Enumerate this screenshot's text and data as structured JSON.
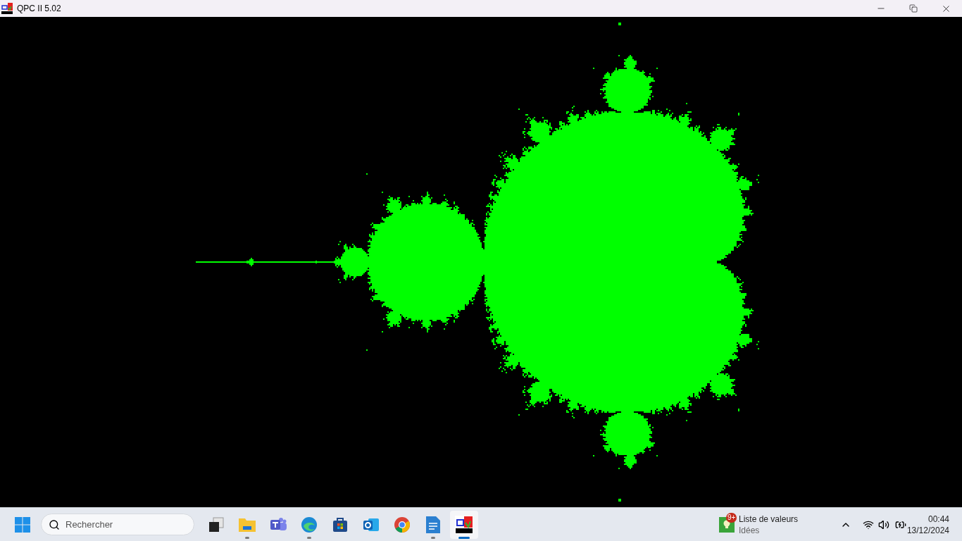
{
  "window": {
    "title": "QPC II 5.02"
  },
  "taskbar": {
    "search": {
      "placeholder": "Rechercher"
    },
    "apps": [
      {
        "kind": "taskview",
        "running": false,
        "selected": false
      },
      {
        "kind": "folder",
        "running": true,
        "selected": false
      },
      {
        "kind": "teams",
        "running": false,
        "selected": false
      },
      {
        "kind": "edge",
        "running": true,
        "selected": false
      },
      {
        "kind": "store",
        "running": false,
        "selected": false
      },
      {
        "kind": "outlook",
        "running": false,
        "selected": false
      },
      {
        "kind": "chrome",
        "running": false,
        "selected": false
      },
      {
        "kind": "writer",
        "running": true,
        "selected": false
      },
      {
        "kind": "qpc",
        "running": true,
        "selected": true
      }
    ],
    "widget": {
      "badge": "9+",
      "title": "Liste de valeurs",
      "subtitle": "Idées"
    },
    "clock": {
      "time": "00:44",
      "date": "13/12/2024"
    }
  }
}
